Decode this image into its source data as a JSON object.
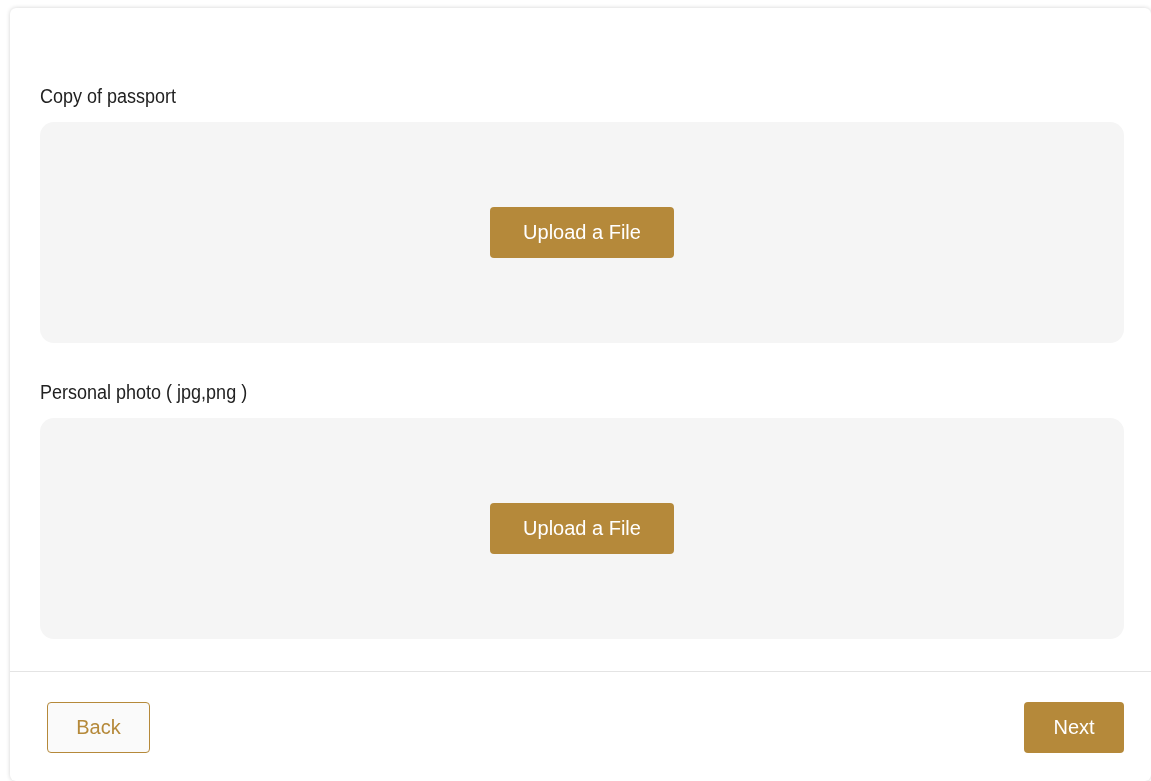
{
  "sections": [
    {
      "label": "Copy of passport",
      "button": "Upload a File"
    },
    {
      "label": "Personal photo ( jpg,png )",
      "button": "Upload a File"
    }
  ],
  "buttons": [
    {
      "label": "Back",
      "kind": "secondary"
    },
    {
      "label": "Next",
      "kind": "primary"
    }
  ]
}
